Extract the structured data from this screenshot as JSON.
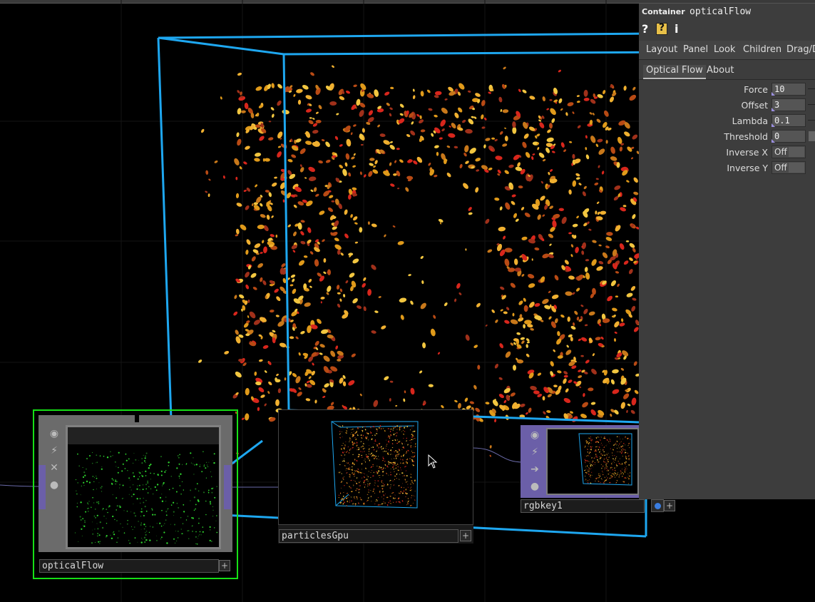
{
  "panel": {
    "op_type": "Container",
    "op_name": "opticalFlow",
    "help_icons": [
      "question-icon",
      "python-help-icon",
      "info-icon"
    ],
    "help_glyphs": [
      "?",
      "?",
      "i"
    ],
    "page_tabs": [
      "Layout",
      "Panel",
      "Look",
      "Children",
      "Drag/D"
    ],
    "sub_tabs": [
      "Optical Flow",
      "About"
    ],
    "params": [
      {
        "label": "Force",
        "value": "10"
      },
      {
        "label": "Offset",
        "value": "3"
      },
      {
        "label": "Lambda",
        "value": "0.1"
      },
      {
        "label": "Threshold",
        "value": "0"
      }
    ],
    "toggles": [
      {
        "label": "Inverse X",
        "value": "Off"
      },
      {
        "label": "Inverse Y",
        "value": "Off"
      }
    ]
  },
  "nodes": {
    "opticalflow": {
      "name": "opticalFlow"
    },
    "particlesgpu": {
      "name": "particlesGpu"
    },
    "rgbkey": {
      "name": "rgbkey1"
    }
  },
  "colors": {
    "wire_cyan": "#1ea7f0",
    "selected_green": "#16e016",
    "leaf_orange": "#e09a1a",
    "leaf_red": "#d8261c",
    "panel_bg": "#3d3d3d"
  }
}
